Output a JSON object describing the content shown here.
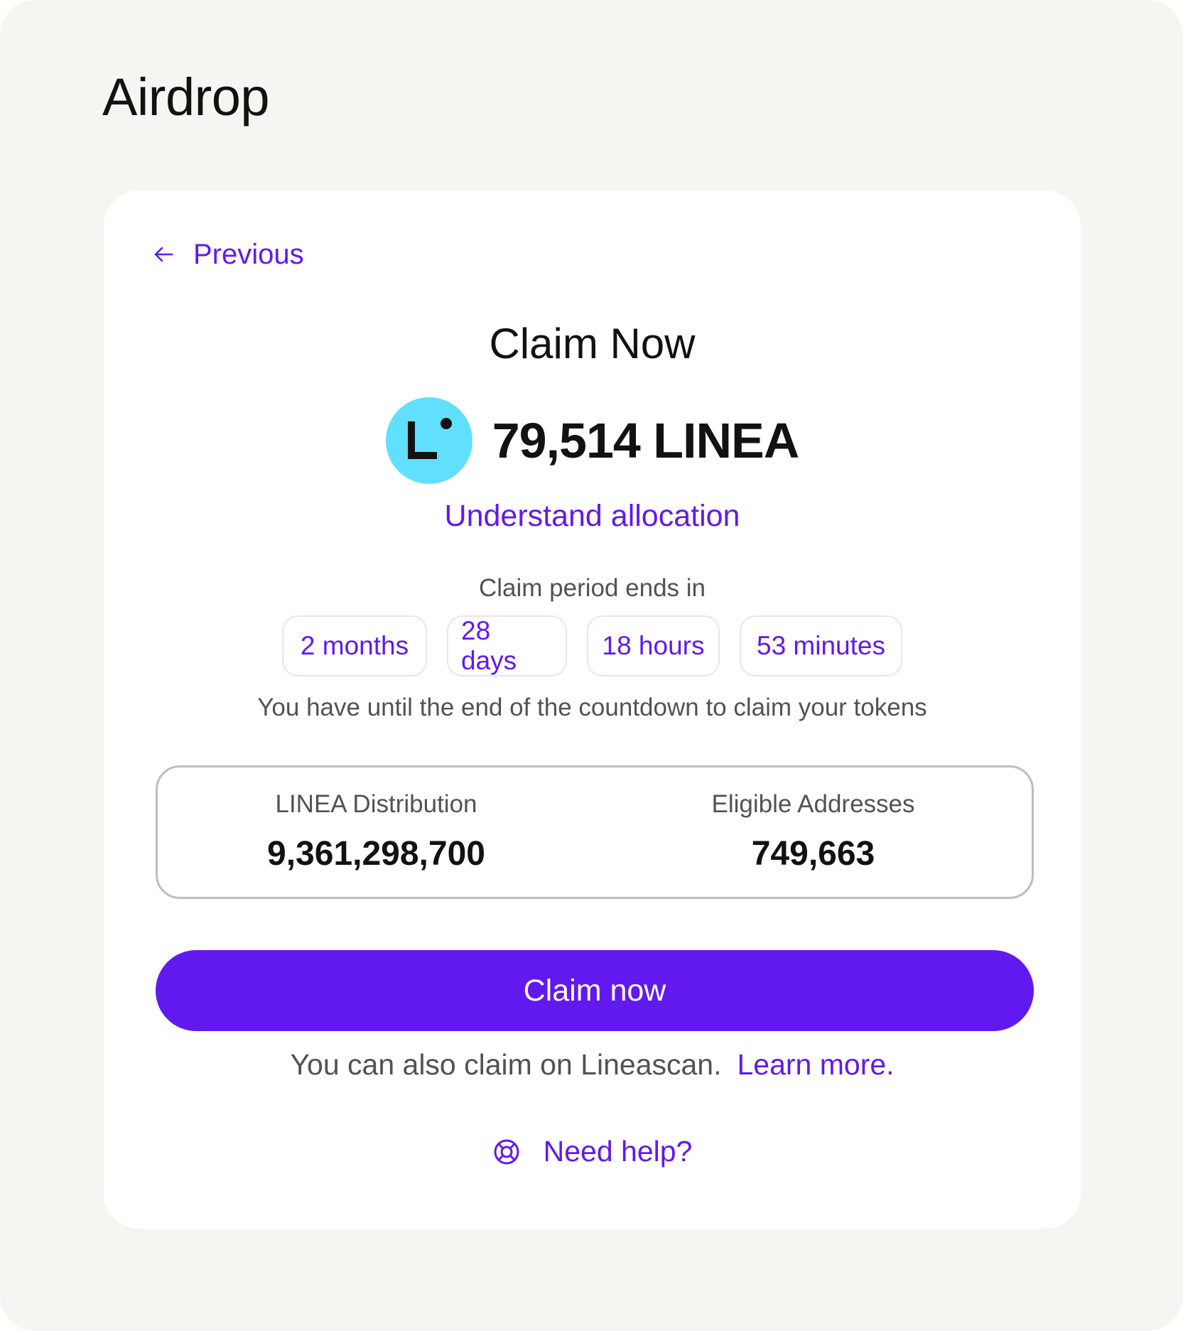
{
  "page": {
    "title": "Airdrop"
  },
  "card": {
    "previous_label": "Previous",
    "heading": "Claim Now",
    "token": {
      "amount": "79,514 LINEA",
      "logo_letter": "L",
      "logo_color": "#61dfff"
    },
    "allocation_link": "Understand allocation",
    "claim_period_label": "Claim period ends in",
    "countdown": [
      {
        "label": "2 months"
      },
      {
        "label": "28 days"
      },
      {
        "label": "18 hours"
      },
      {
        "label": "53 minutes"
      }
    ],
    "countdown_note": "You have until the end of the countdown to claim your tokens",
    "stats": {
      "distribution_label": "LINEA Distribution",
      "distribution_value": "9,361,298,700",
      "eligible_label": "Eligible Addresses",
      "eligible_value": "749,663"
    },
    "claim_button": "Claim now",
    "alt_claim_text": "You can also claim on Lineascan.",
    "learn_more": "Learn more.",
    "help_label": "Need help?"
  },
  "colors": {
    "accent": "#6119ef",
    "background": "#f6f5f1",
    "card": "#ffffff",
    "text": "#121212",
    "muted_text": "#525252"
  },
  "icons": {
    "back": "arrow-left-icon",
    "help": "lifebuoy-icon",
    "token": "linea-logo"
  }
}
